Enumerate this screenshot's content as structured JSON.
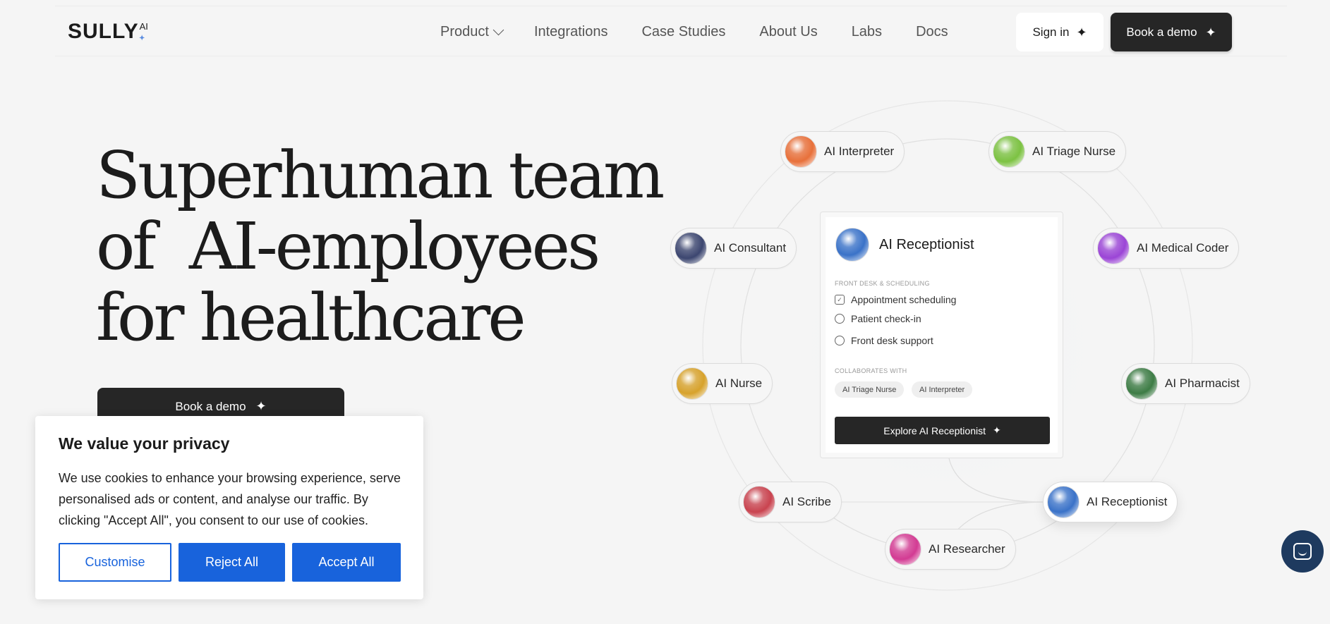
{
  "brand": {
    "name": "SULLY",
    "suffix": "AI"
  },
  "nav": {
    "product": "Product",
    "integrations": "Integrations",
    "case_studies": "Case Studies",
    "about": "About Us",
    "labs": "Labs",
    "docs": "Docs",
    "sign_in": "Sign in",
    "book_demo": "Book a demo"
  },
  "hero": {
    "line1": "Superhuman team",
    "line2": "of  AI-employees",
    "line3": "for healthcare",
    "cta": "Book a demo"
  },
  "cookie": {
    "title": "We value your privacy",
    "body": "We use cookies to enhance your browsing experience, serve personalised ads or content, and analyse our traffic. By clicking \"Accept All\", you consent to our use of cookies.",
    "customise": "Customise",
    "reject": "Reject All",
    "accept": "Accept All"
  },
  "orbit_chips": [
    {
      "label": "AI Interpreter",
      "orb_color": "#e8703a"
    },
    {
      "label": "AI Triage Nurse",
      "orb_color": "#7cc242"
    },
    {
      "label": "AI Consultant",
      "orb_color": "#3c4670"
    },
    {
      "label": "AI Medical Coder",
      "orb_color": "#9b45d6"
    },
    {
      "label": "AI Nurse",
      "orb_color": "#d7a22c"
    },
    {
      "label": "AI Pharmacist",
      "orb_color": "#3d7c45"
    },
    {
      "label": "AI Scribe",
      "orb_color": "#c9434f"
    },
    {
      "label": "AI Receptionist",
      "orb_color": "#3a72c8"
    },
    {
      "label": "AI Researcher",
      "orb_color": "#d33b93"
    }
  ],
  "card": {
    "title": "AI Receptionist",
    "orb_color": "#3a72c8",
    "section1": "FRONT DESK & SCHEDULING",
    "items": [
      "Appointment scheduling",
      "Patient check-in",
      "Front desk support"
    ],
    "section2": "COLLABORATES WITH",
    "collaborators": [
      "AI Triage Nurse",
      "AI Interpreter"
    ],
    "cta": "Explore AI Receptionist"
  },
  "icons": {
    "sparkle": "✦",
    "chat": "chat-icon"
  }
}
